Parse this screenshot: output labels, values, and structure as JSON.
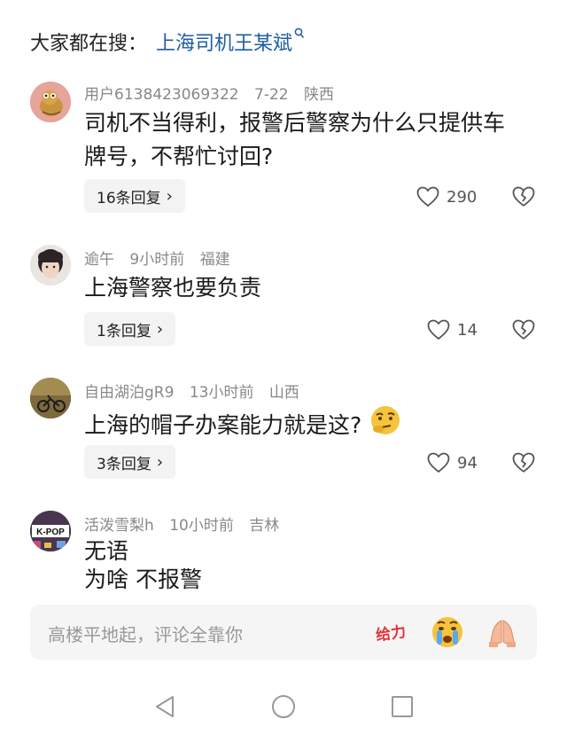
{
  "search": {
    "prefix": "大家都在搜：",
    "query": "上海司机王某斌"
  },
  "comments": [
    {
      "user": "用户6138423069322",
      "time": "7-22",
      "location": "陕西",
      "text_line1": "司机不当得利，报警后警察为什么只提供车",
      "text_line2": "牌号，不帮忙讨回?",
      "replies": "16条回复",
      "likes": "290"
    },
    {
      "user": "逾午",
      "time": "9小时前",
      "location": "福建",
      "text_line1": "上海警察也要负责",
      "replies": "1条回复",
      "likes": "14"
    },
    {
      "user": "自由湖泊gR9",
      "time": "13小时前",
      "location": "山西",
      "text_line1": "上海的帽子办案能力就是这?",
      "emoji": "thinking-face-emoji",
      "replies": "3条回复",
      "likes": "94"
    },
    {
      "user": "活泼雪梨h",
      "time": "10小时前",
      "location": "吉林",
      "text_line1": "无语",
      "text_line2": "为啥 不报警",
      "avatar_text": "K-POP"
    }
  ],
  "input": {
    "placeholder": "高楼平地起，评论全靠你",
    "quick_emojis": [
      "给力",
      "crying-face",
      "praying-hands"
    ]
  },
  "colors": {
    "link": "#1e5ea0",
    "meta": "#888888",
    "pill_bg": "#f3f3f3"
  }
}
